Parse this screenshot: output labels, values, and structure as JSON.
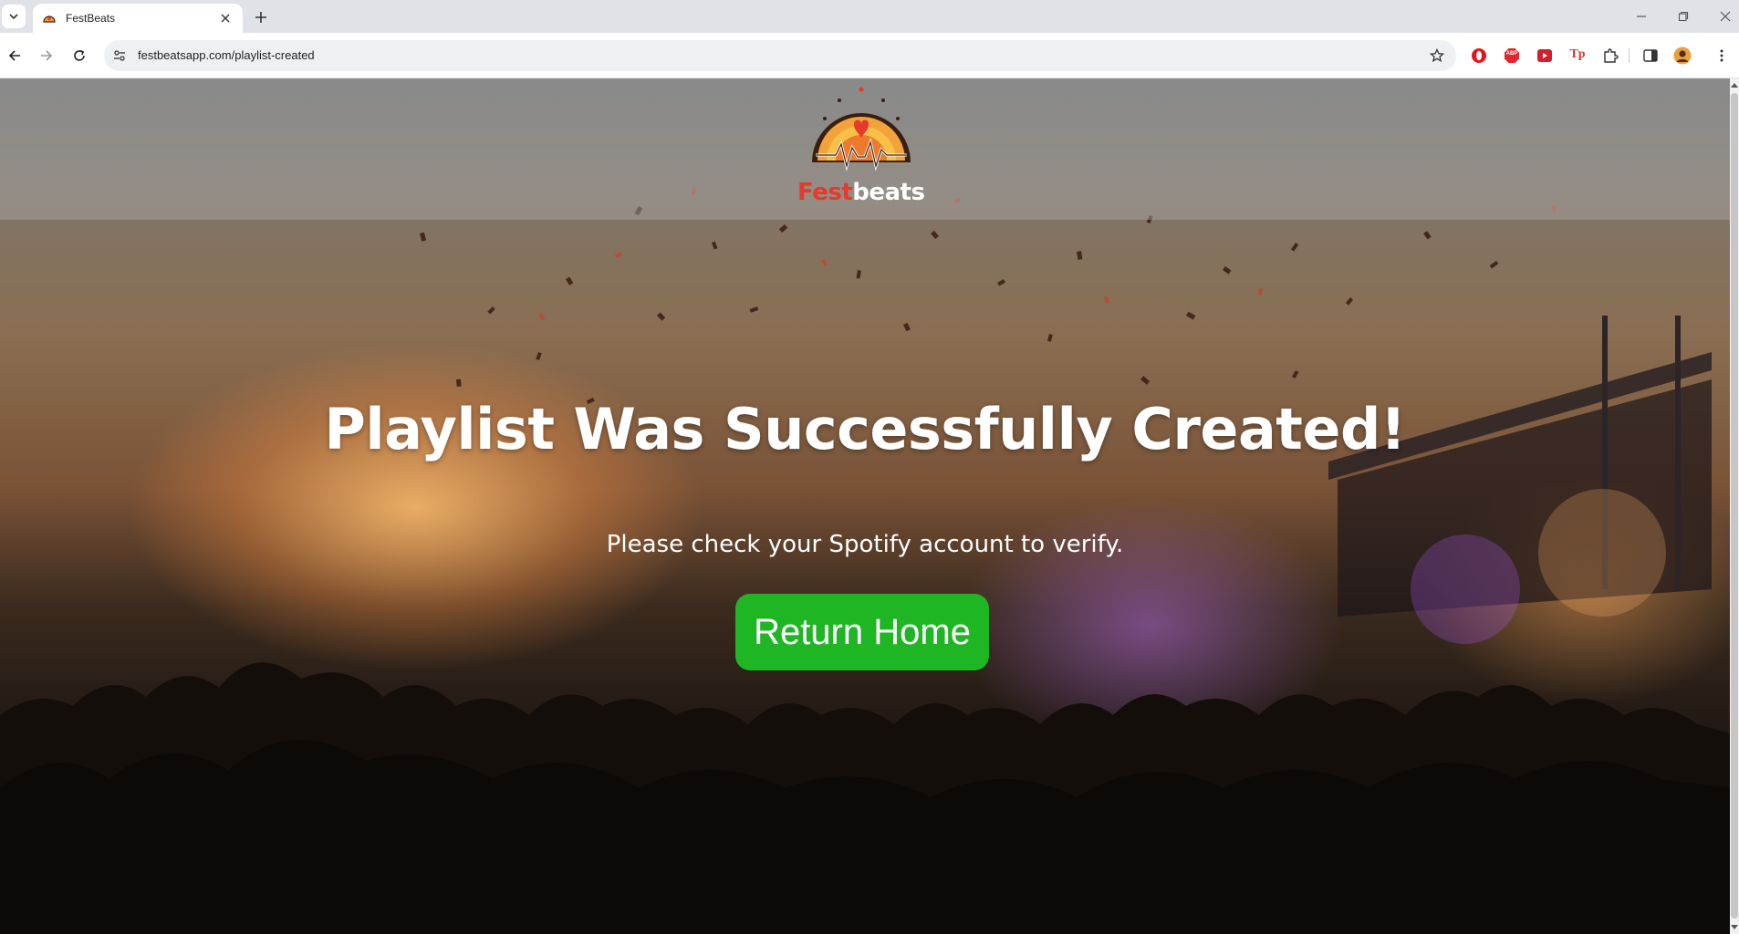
{
  "browser": {
    "tab_title": "FestBeats",
    "url": "festbeatsapp.com/playlist-created",
    "extensions": [
      "opera-icon",
      "adblock-icon",
      "media-icon",
      "tp-icon",
      "puzzle-icon"
    ],
    "extension_labels": {
      "adblock": "ABP",
      "tp": "Tp"
    }
  },
  "page": {
    "logo": {
      "text_first": "Fest",
      "text_second": "beats"
    },
    "headline": "Playlist Was Successfully Created!",
    "subtext": "Please check your Spotify account to verify.",
    "return_button": "Return Home"
  },
  "colors": {
    "button_green": "#1fb624",
    "logo_red": "#e43a2c",
    "text_white": "#ffffff"
  }
}
